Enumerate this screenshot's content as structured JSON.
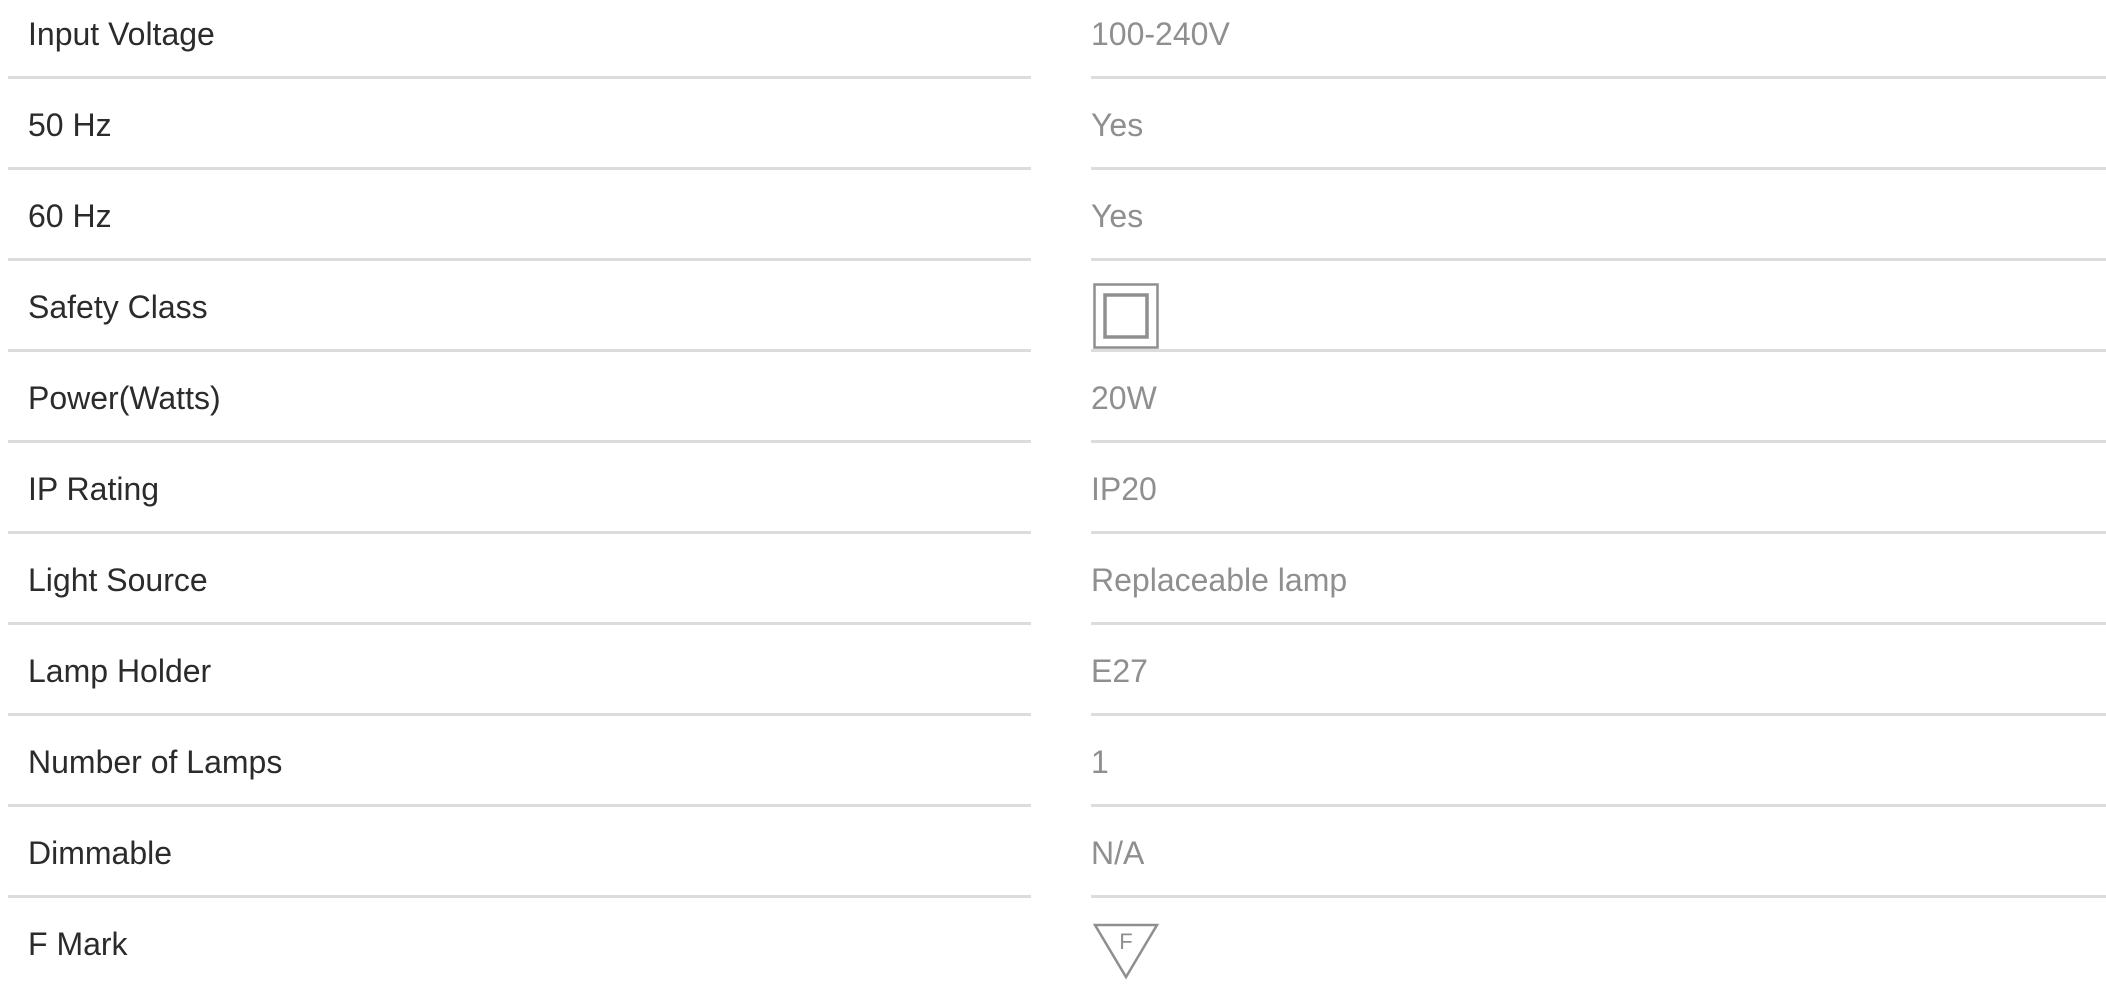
{
  "specs": [
    {
      "label": "Input Voltage",
      "value": "100-240V"
    },
    {
      "label": "50 Hz",
      "value": "Yes"
    },
    {
      "label": "60 Hz",
      "value": "Yes"
    },
    {
      "label": "Safety Class",
      "icon": "class-ii-double-square-icon"
    },
    {
      "label": "Power(Watts)",
      "value": "20W"
    },
    {
      "label": "IP Rating",
      "value": "IP20"
    },
    {
      "label": "Light Source",
      "value": "Replaceable lamp"
    },
    {
      "label": "Lamp Holder",
      "value": "E27"
    },
    {
      "label": "Number of Lamps",
      "value": "1"
    },
    {
      "label": "Dimmable",
      "value": "N/A"
    },
    {
      "label": "F Mark",
      "icon": "f-mark-triangle-icon",
      "icon_text": "F"
    }
  ],
  "colors": {
    "label_text": "#2b2b2b",
    "value_text": "#8f8f8f",
    "divider": "#dcdcdc",
    "icon_stroke": "#8f8f8f"
  }
}
